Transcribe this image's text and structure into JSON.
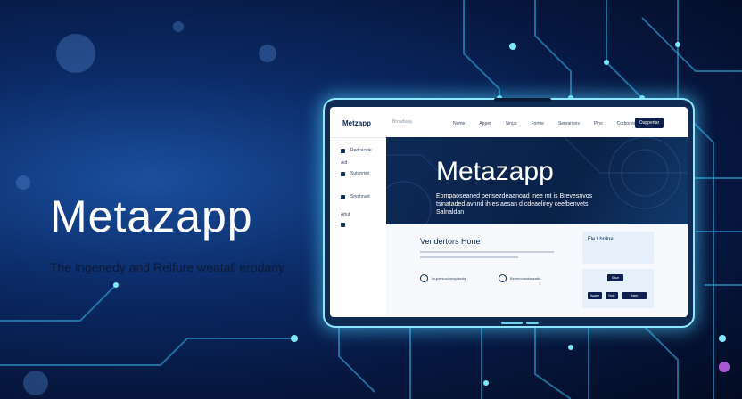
{
  "hero": {
    "title": "Metazapp",
    "tagline": "The ingenedy and Relfure weatall erodany"
  },
  "app": {
    "logo": "Metzapp",
    "logo_sub": "Broadway",
    "nav": [
      "Nome",
      "Apper",
      "Sinuo",
      "Forme",
      "Servarions",
      "Plns",
      "Corbonar"
    ],
    "cta_label": "Ouppertar",
    "sidebar": [
      {
        "label": "Redcecele",
        "icon": "doc-icon"
      },
      {
        "label": "Sutuprise",
        "icon": "user-icon"
      },
      {
        "label": "Srechnart",
        "icon": "mail-icon"
      },
      {
        "label": "",
        "icon": "grid-icon"
      }
    ],
    "sidebar_headings": [
      "Aid",
      "Ahut"
    ],
    "banner": {
      "title": "Metazapp",
      "description": "Eompaoseaned perisezdeaanoad inee mt is Brevesnvos tsinataded avnnd ih es aesan d cdeaelirey ceefbenvets Salnaldan"
    },
    "features": {
      "title": "Vendertors Hone",
      "cards": [
        "Ieupresocdonaplseda",
        "Bexmocarstonsatta"
      ]
    },
    "panel_a_title": "Fle Lhrdne",
    "panel_b_buttons": [
      "Saue",
      "Aoaee",
      "Noie",
      "Saee"
    ]
  },
  "colors": {
    "accent": "#0e1f4d",
    "glow": "#8fe6ff",
    "bg_dark": "#06163d"
  }
}
